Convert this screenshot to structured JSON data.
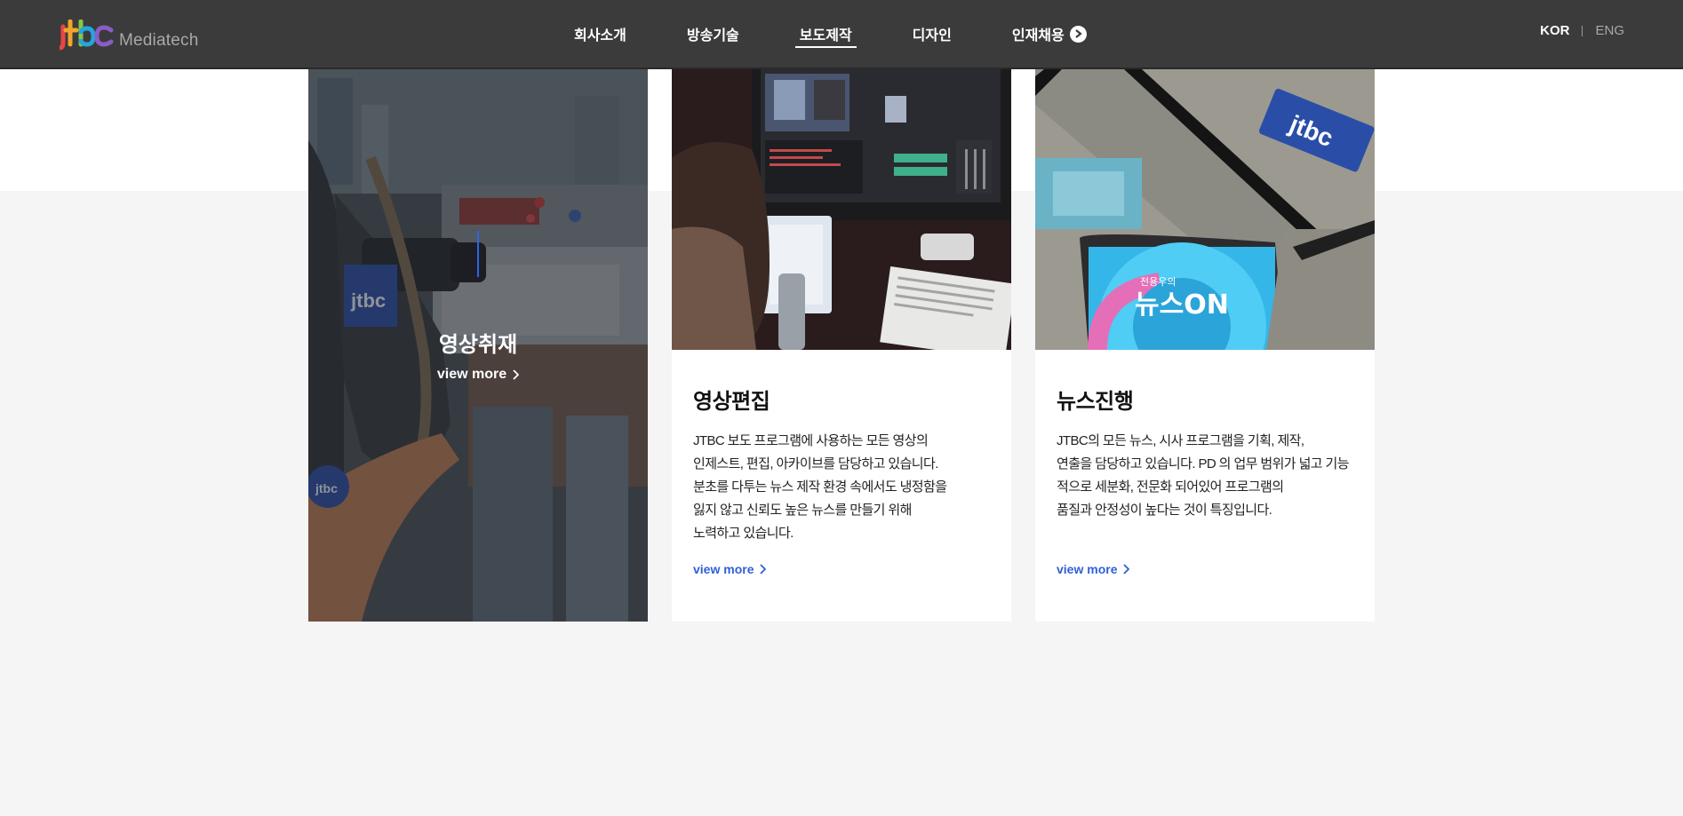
{
  "header": {
    "logo_text": "Mediatech",
    "logo_icon": "jtbc-logo",
    "nav": [
      {
        "label": "회사소개"
      },
      {
        "label": "방송기술"
      },
      {
        "label": "보도제작",
        "active": true
      },
      {
        "label": "디자인"
      },
      {
        "label": "인재채용",
        "icon": "chevron-right-circle-icon"
      }
    ],
    "lang": {
      "kor": "KOR",
      "eng": "ENG"
    }
  },
  "cards": [
    {
      "title": "영상취재",
      "more": "view more",
      "image": "camera-operator-photo",
      "hovered": true
    },
    {
      "title": "영상편집",
      "desc": [
        "JTBC 보도 프로그램에 사용하는 모든 영상의",
        "인제스트, 편집, 아카이브를 담당하고 있습니다.",
        "분초를 다투는 뉴스 제작 환경 속에서도 냉정함을",
        "잃지 않고 신뢰도 높은 뉴스를 만들기 위해",
        "노력하고 있습니다."
      ],
      "more": "view more",
      "image": "video-editing-photo"
    },
    {
      "title": "뉴스진행",
      "desc": [
        "JTBC의 모든 뉴스, 시사 프로그램을 기획, 제작,",
        "연출을 담당하고 있습니다. PD 의 업무 범위가 넓고 기능",
        "적으로 세분화, 전문화 되어있어 프로그램의",
        "품질과 안정성이 높다는 것이 특징입니다."
      ],
      "more": "view more",
      "image": "news-studio-photo",
      "image_caption": "뉴스ON",
      "image_brand": "jtbc",
      "image_small_caption": "전용우의"
    }
  ],
  "colors": {
    "header_bg": "#3b3b3b",
    "accent": "#2f5fd8",
    "page_bg": "#f5f5f5"
  }
}
